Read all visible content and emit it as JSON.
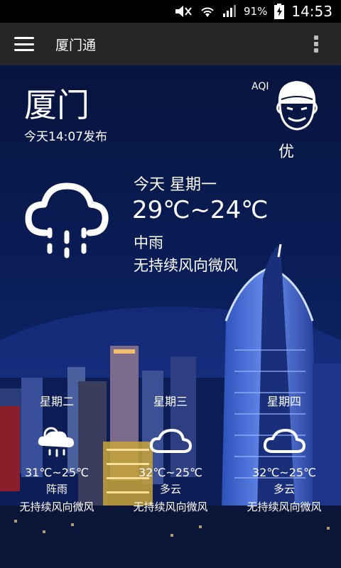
{
  "status_bar": {
    "battery": "91%",
    "time": "14:53",
    "icons": [
      "mute-icon",
      "wifi-icon",
      "signal-icon",
      "battery-charging-icon"
    ]
  },
  "app_bar": {
    "title": "厦门通",
    "icons": [
      "menu-icon",
      "more-vert-icon"
    ]
  },
  "weather": {
    "city": "厦门",
    "publish_time": "今天14:07发布",
    "aqi_label": "AQI",
    "aqi_value": "优",
    "aqi_icon": "face-icon",
    "today": {
      "day": "今天 星期一",
      "temp": "29℃~24℃",
      "condition": "中雨",
      "wind": "无持续风向微风",
      "icon": "rain-cloud-icon"
    },
    "forecast": [
      {
        "day": "星期二",
        "temp": "31℃~25℃",
        "condition": "阵雨",
        "wind": "无持续风向微风",
        "icon": "shower-cloud-icon"
      },
      {
        "day": "星期三",
        "temp": "32℃~25℃",
        "condition": "多云",
        "wind": "无持续风向微风",
        "icon": "cloud-icon"
      },
      {
        "day": "星期四",
        "temp": "32℃~25℃",
        "condition": "多云",
        "wind": "无持续风向微风",
        "icon": "cloud-icon"
      }
    ]
  }
}
